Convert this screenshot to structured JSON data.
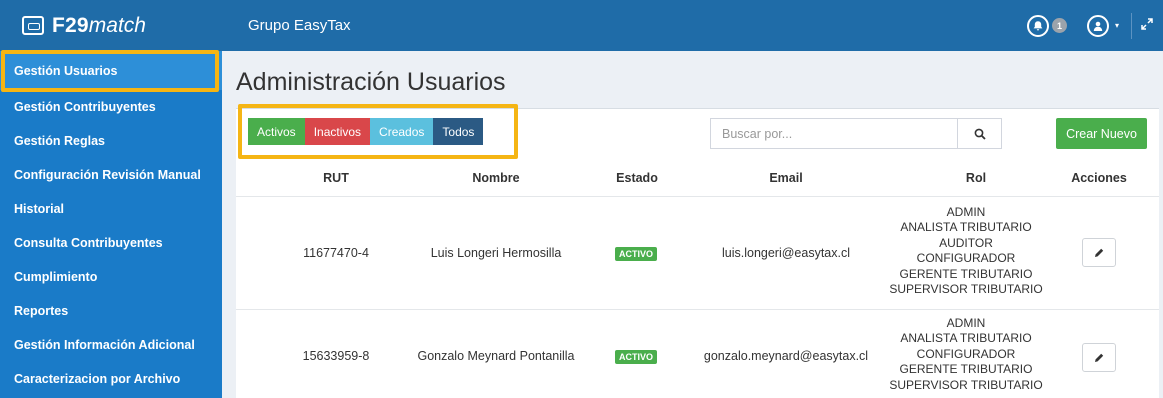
{
  "brand": {
    "name_bold": "F29",
    "name_italic": "match"
  },
  "sidebar": {
    "items": [
      {
        "label": "Gestión Usuarios"
      },
      {
        "label": "Gestión Contribuyentes"
      },
      {
        "label": "Gestión Reglas"
      },
      {
        "label": "Configuración Revisión Manual"
      },
      {
        "label": "Historial"
      },
      {
        "label": "Consulta Contribuyentes"
      },
      {
        "label": "Cumplimiento"
      },
      {
        "label": "Reportes"
      },
      {
        "label": "Gestión Información Adicional"
      },
      {
        "label": "Caracterizacion por Archivo"
      }
    ]
  },
  "topbar": {
    "org": "Grupo EasyTax",
    "notification_count": "1"
  },
  "page": {
    "title": "Administración Usuarios"
  },
  "filters": {
    "activos": "Activos",
    "inactivos": "Inactivos",
    "creados": "Creados",
    "todos": "Todos"
  },
  "search": {
    "placeholder": "Buscar por...",
    "value": ""
  },
  "actions": {
    "new_label": "Crear Nuevo"
  },
  "table": {
    "headers": {
      "rut": "RUT",
      "nombre": "Nombre",
      "estado": "Estado",
      "email": "Email",
      "rol": "Rol",
      "acciones": "Acciones"
    },
    "rows": [
      {
        "rut": "11677470-4",
        "nombre": "Luis Longeri Hermosilla",
        "estado": "ACTIVO",
        "email": "luis.longeri@easytax.cl",
        "roles": [
          "ADMIN",
          "ANALISTA TRIBUTARIO",
          "AUDITOR",
          "CONFIGURADOR",
          "GERENTE TRIBUTARIO",
          "SUPERVISOR TRIBUTARIO"
        ]
      },
      {
        "rut": "15633959-8",
        "nombre": "Gonzalo Meynard Pontanilla",
        "estado": "ACTIVO",
        "email": "gonzalo.meynard@easytax.cl",
        "roles": [
          "ADMIN",
          "ANALISTA TRIBUTARIO",
          "CONFIGURADOR",
          "GERENTE TRIBUTARIO",
          "SUPERVISOR TRIBUTARIO"
        ]
      }
    ]
  },
  "colors": {
    "sidebar": "#1a7bc8",
    "topbar": "#1f6ca8",
    "active_item": "#2d8fd8",
    "highlight": "#f5b514",
    "success": "#4aae4c",
    "danger": "#d9474a",
    "info": "#5bc0de",
    "primary": "#2b5a84"
  },
  "icons": {
    "logo": "f29-logo-icon",
    "bell": "bell-icon",
    "user": "user-icon",
    "expand": "expand-icon",
    "search": "search-icon",
    "edit": "pencil-icon"
  }
}
